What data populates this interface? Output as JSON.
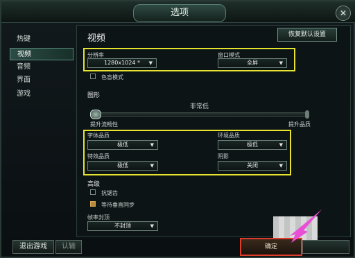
{
  "window": {
    "title": "选项",
    "close_label": "✕"
  },
  "sidebar": {
    "items": [
      {
        "label": "热键",
        "active": false
      },
      {
        "label": "视频",
        "active": true
      },
      {
        "label": "音频",
        "active": false
      },
      {
        "label": "界面",
        "active": false
      },
      {
        "label": "游戏",
        "active": false
      }
    ]
  },
  "main": {
    "section_title": "视频",
    "reset_button": "恢复默认设置",
    "resolution": {
      "label": "分辨率",
      "value": "1280x1024 *"
    },
    "window_mode": {
      "label": "窗口模式",
      "value": "全屏"
    },
    "colorblind": {
      "label": "色盲模式",
      "checked": false
    },
    "graphics": {
      "heading": "图形",
      "level_label": "非常低",
      "slider_left": "提升流畅性",
      "slider_right": "提升品质",
      "slider_fraction": 0.0
    },
    "quality": {
      "character": {
        "label": "字体品质",
        "value": "极低"
      },
      "environment": {
        "label": "环境品质",
        "value": "极低"
      },
      "effects": {
        "label": "特效品质",
        "value": "极低"
      },
      "shadows": {
        "label": "阴影",
        "value": "关闭"
      }
    },
    "advanced": {
      "heading": "高级",
      "antialias": {
        "label": "抗锯齿",
        "checked": false
      },
      "vsync": {
        "label": "等待垂直同步",
        "checked": true
      },
      "framerate": {
        "label": "帧率封顶",
        "value": "不封顶"
      }
    }
  },
  "bottom": {
    "exit_game": "退出游戏",
    "surrender": "认输",
    "confirm": "确定"
  },
  "colors": {
    "highlight_box": "#e7e430",
    "confirm_highlight": "#e03c2c",
    "arrow": "#e84fd6"
  }
}
